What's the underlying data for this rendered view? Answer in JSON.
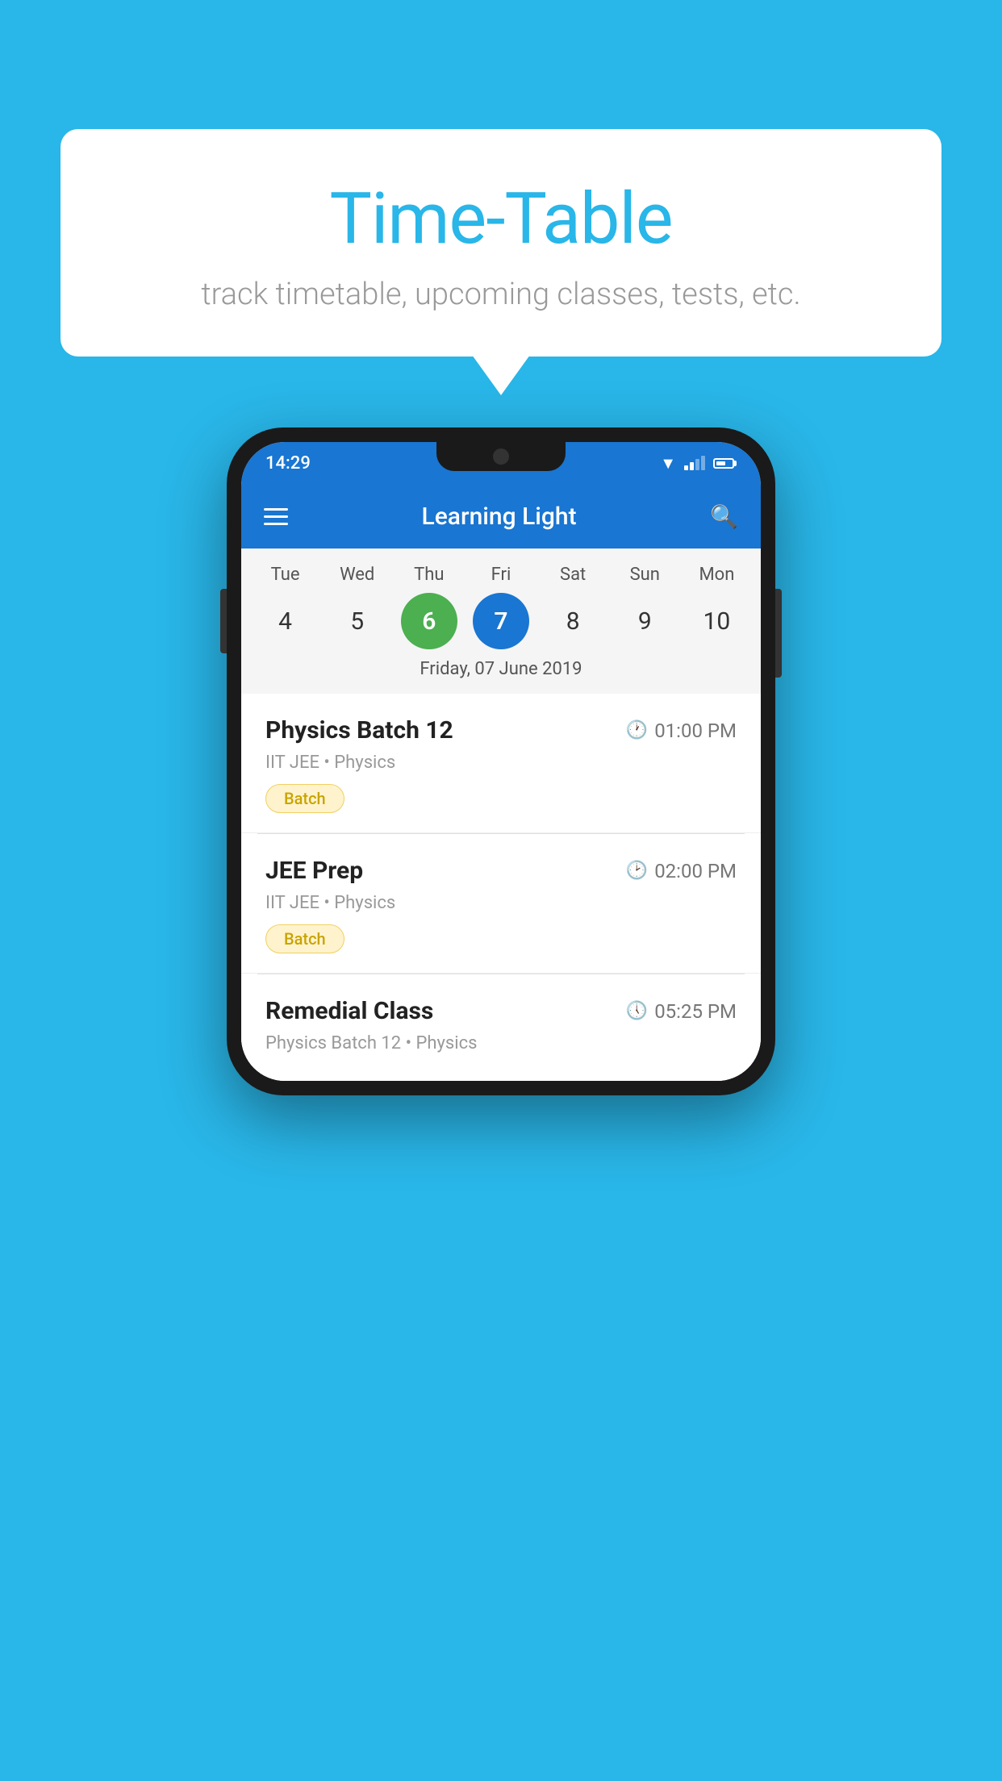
{
  "background_color": "#29B6E8",
  "speech_bubble": {
    "title": "Time-Table",
    "subtitle": "track timetable, upcoming classes, tests, etc."
  },
  "phone": {
    "status_bar": {
      "time": "14:29"
    },
    "app_bar": {
      "title": "Learning Light"
    },
    "calendar": {
      "days": [
        {
          "name": "Tue",
          "number": "4",
          "state": "normal"
        },
        {
          "name": "Wed",
          "number": "5",
          "state": "normal"
        },
        {
          "name": "Thu",
          "number": "6",
          "state": "today"
        },
        {
          "name": "Fri",
          "number": "7",
          "state": "selected"
        },
        {
          "name": "Sat",
          "number": "8",
          "state": "normal"
        },
        {
          "name": "Sun",
          "number": "9",
          "state": "normal"
        },
        {
          "name": "Mon",
          "number": "10",
          "state": "normal"
        }
      ],
      "selected_date_label": "Friday, 07 June 2019"
    },
    "schedule": [
      {
        "title": "Physics Batch 12",
        "time": "01:00 PM",
        "subtitle": "IIT JEE • Physics",
        "badge": "Batch"
      },
      {
        "title": "JEE Prep",
        "time": "02:00 PM",
        "subtitle": "IIT JEE • Physics",
        "badge": "Batch"
      },
      {
        "title": "Remedial Class",
        "time": "05:25 PM",
        "subtitle": "Physics Batch 12 • Physics",
        "badge": ""
      }
    ]
  }
}
